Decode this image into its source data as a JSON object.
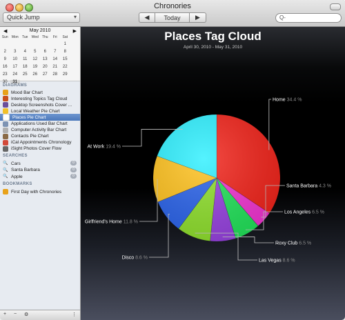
{
  "window": {
    "title": "Chronories"
  },
  "toolbar": {
    "quick_jump": "Quick Jump",
    "today": "Today",
    "prev_icon": "triangle-left",
    "next_icon": "triangle-right",
    "search_placeholder": "Q-"
  },
  "calendar": {
    "month": "May 2010",
    "days_of_week": [
      "Sun",
      "Mon",
      "Tue",
      "Wed",
      "Thu",
      "Fri",
      "Sat"
    ],
    "weeks": [
      [
        "",
        "",
        "",
        "",
        "",
        "",
        "1"
      ],
      [
        "2",
        "3",
        "4",
        "5",
        "6",
        "7",
        "8"
      ],
      [
        "9",
        "10",
        "11",
        "12",
        "13",
        "14",
        "15"
      ],
      [
        "16",
        "17",
        "18",
        "19",
        "20",
        "21",
        "22"
      ],
      [
        "23",
        "24",
        "25",
        "26",
        "27",
        "28",
        "29"
      ],
      [
        "30",
        "31",
        "",
        "",
        "",
        "",
        ""
      ]
    ],
    "selected": "31"
  },
  "sidebar": {
    "diagrams_header": "DIAGRAMS",
    "diagrams": [
      {
        "label": "Mood Bar Chart",
        "icon": "mood-icon",
        "color": "#e8a21a"
      },
      {
        "label": "Interesting Topics Tag Cloud",
        "icon": "topics-icon",
        "color": "#c84f1c"
      },
      {
        "label": "Desktop Screenshots Cover ...",
        "icon": "screenshot-icon",
        "color": "#6b4e9a"
      },
      {
        "label": "Local Weather Pie Chart",
        "icon": "weather-icon",
        "color": "#f2c029"
      },
      {
        "label": "Places Pie Chart",
        "icon": "places-icon",
        "color": "#ffffff"
      },
      {
        "label": "Applications Used Bar Chart",
        "icon": "applications-icon",
        "color": "#7d93b3"
      },
      {
        "label": "Computer Activity Bar Chart",
        "icon": "activity-icon",
        "color": "#b0b0b0"
      },
      {
        "label": "Contacts Pie Chart",
        "icon": "contacts-icon",
        "color": "#8a6a46"
      },
      {
        "label": "iCal Appointments Chronology",
        "icon": "ical-icon",
        "color": "#d24a3a"
      },
      {
        "label": "iSight Photos Cover Flow",
        "icon": "isight-icon",
        "color": "#666666"
      }
    ],
    "selected_index": 4,
    "searches_header": "SEARCHES",
    "searches": [
      {
        "label": "Cars",
        "count": "0"
      },
      {
        "label": "Santa Barbara",
        "count": "0"
      },
      {
        "label": "Apple",
        "count": "0"
      }
    ],
    "bookmarks_header": "BOOKMARKS",
    "bookmarks": [
      {
        "label": "First Day with Chronories",
        "icon": "bookmark-icon",
        "color": "#e8a21a"
      }
    ],
    "bottom": {
      "add": "+",
      "remove": "−",
      "gear": "⚙"
    }
  },
  "chart_data": {
    "type": "pie",
    "title": "Places Tag Cloud",
    "subtitle": "April 30, 2010 - May 31, 2010",
    "slices": [
      {
        "label": "Home",
        "value": 34.4,
        "color": "#f2241b"
      },
      {
        "label": "Santa Barbara",
        "value": 4.3,
        "color": "#f235d2"
      },
      {
        "label": "Los Angeles",
        "value": 6.5,
        "color": "#22e35a"
      },
      {
        "label": "Roxy Club",
        "value": 6.5,
        "color": "#9742e0"
      },
      {
        "label": "Las Vegas",
        "value": 8.6,
        "color": "#8fe02d"
      },
      {
        "label": "Disco",
        "value": 8.6,
        "color": "#2a63ea"
      },
      {
        "label": "Girlfriend's Home",
        "value": 11.8,
        "color": "#ffc21e"
      },
      {
        "label": "At Work",
        "value": 19.4,
        "color": "#2ff0ff"
      }
    ],
    "value_suffix": " %"
  }
}
